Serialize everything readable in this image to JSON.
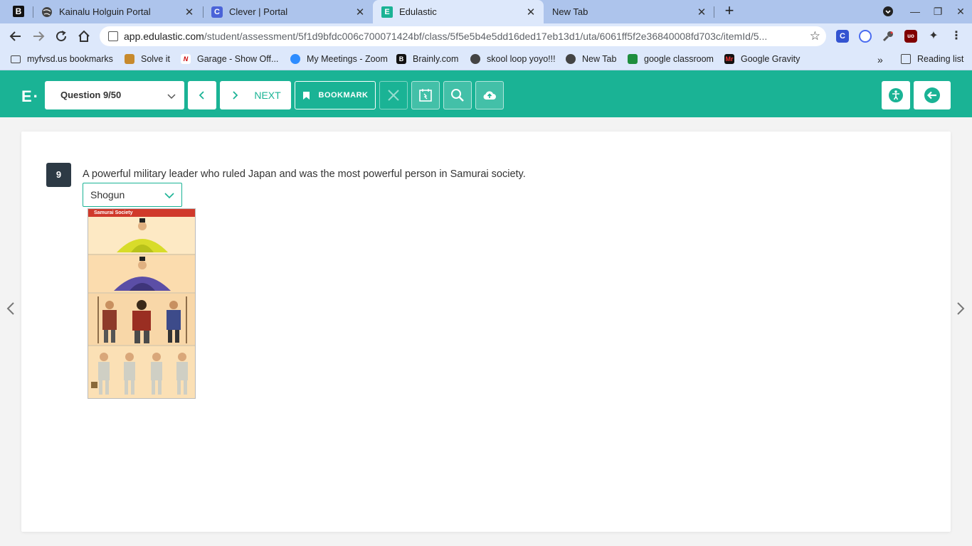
{
  "browser": {
    "tabs": [
      {
        "title": "Kainalu Holguin Portal",
        "active": false
      },
      {
        "title": "Clever | Portal",
        "active": false
      },
      {
        "title": "Edulastic",
        "active": true
      },
      {
        "title": "New Tab",
        "active": false
      }
    ],
    "pinned_icon_letter": "B",
    "url_host": "app.edulastic.com",
    "url_path": "/student/assessment/5f1d9bfdc006c700071424bf/class/5f5e5b4e5dd16ded17eb13d1/uta/6061ff5f2e36840008fd703c/itemId/5...",
    "extensions": [
      {
        "name": "clever-extension-icon",
        "letter": "C",
        "color": "#3454d1"
      },
      {
        "name": "shield-extension-icon",
        "letter": "",
        "color": "#4a6cf0"
      },
      {
        "name": "paint-extension-icon",
        "letter": "",
        "color": "#555555"
      },
      {
        "name": "ublock-extension-icon",
        "letter": "uo",
        "color": "#800000"
      }
    ],
    "bookmarks": [
      "myfvsd.us bookmarks",
      "Solve it",
      "Garage - Show Off...",
      "My Meetings - Zoom",
      "Brainly.com",
      "skool loop yoyo!!!",
      "New Tab",
      "google classroom",
      "Google Gravity"
    ],
    "reading_list": "Reading list"
  },
  "header": {
    "logo": "E·",
    "question_select": "Question 9/50",
    "next_label": "NEXT",
    "bookmark_label": "BOOKMARK"
  },
  "question": {
    "number": "9",
    "text": "A powerful military leader who ruled Japan and was the most powerful person in Samurai society.",
    "selected_answer": "Shogun",
    "image_banner": "Samurai Society"
  },
  "colors": {
    "brand": "#1ab395",
    "dark_badge": "#2d3a45"
  }
}
